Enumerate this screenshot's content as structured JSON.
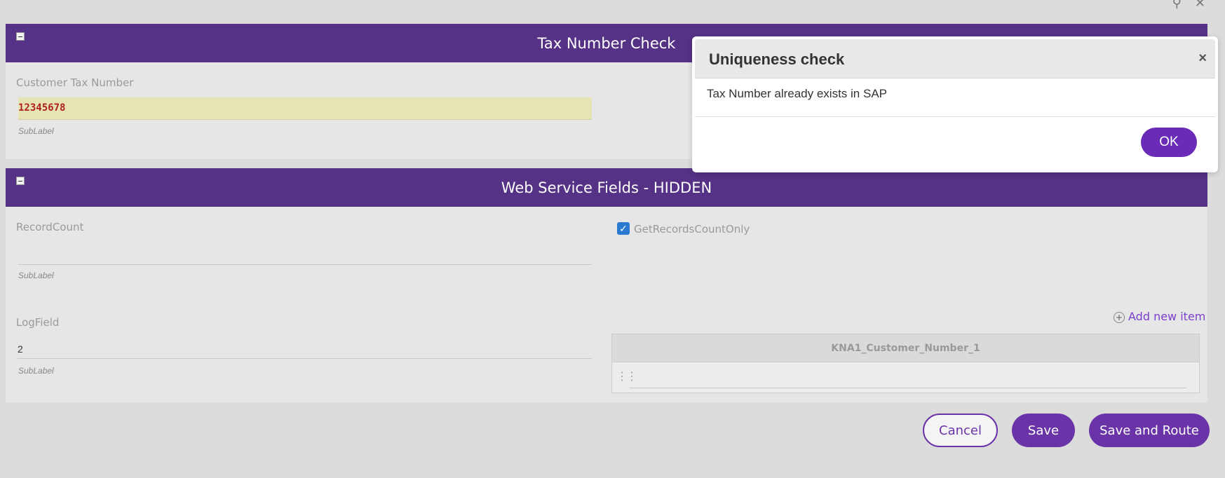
{
  "window": {
    "link_icon": "⚲",
    "close_icon": "✕"
  },
  "panel_tax": {
    "title": "Tax Number Check",
    "field_label": "Customer Tax Number",
    "field_value": "12345678",
    "sublabel": "SubLabel"
  },
  "panel_ws": {
    "title": "Web Service Fields - HIDDEN",
    "record_count_label": "RecordCount",
    "record_count_value": "",
    "record_count_sublabel": "SubLabel",
    "checkbox_label": "GetRecordsCountOnly",
    "checkbox_checked": true,
    "log_label": "LogField",
    "log_value": "2",
    "log_sublabel": "SubLabel",
    "add_item_label": "Add new item",
    "grid_column": "KNA1_Customer_Number_1"
  },
  "footer": {
    "cancel": "Cancel",
    "save": "Save",
    "save_route": "Save and Route"
  },
  "modal": {
    "title": "Uniqueness check",
    "message": "Tax Number already exists in SAP",
    "ok": "OK",
    "close": "×"
  },
  "colors": {
    "brand": "#553285",
    "button": "#6a34a8",
    "highlight": "#e6e3b4"
  }
}
